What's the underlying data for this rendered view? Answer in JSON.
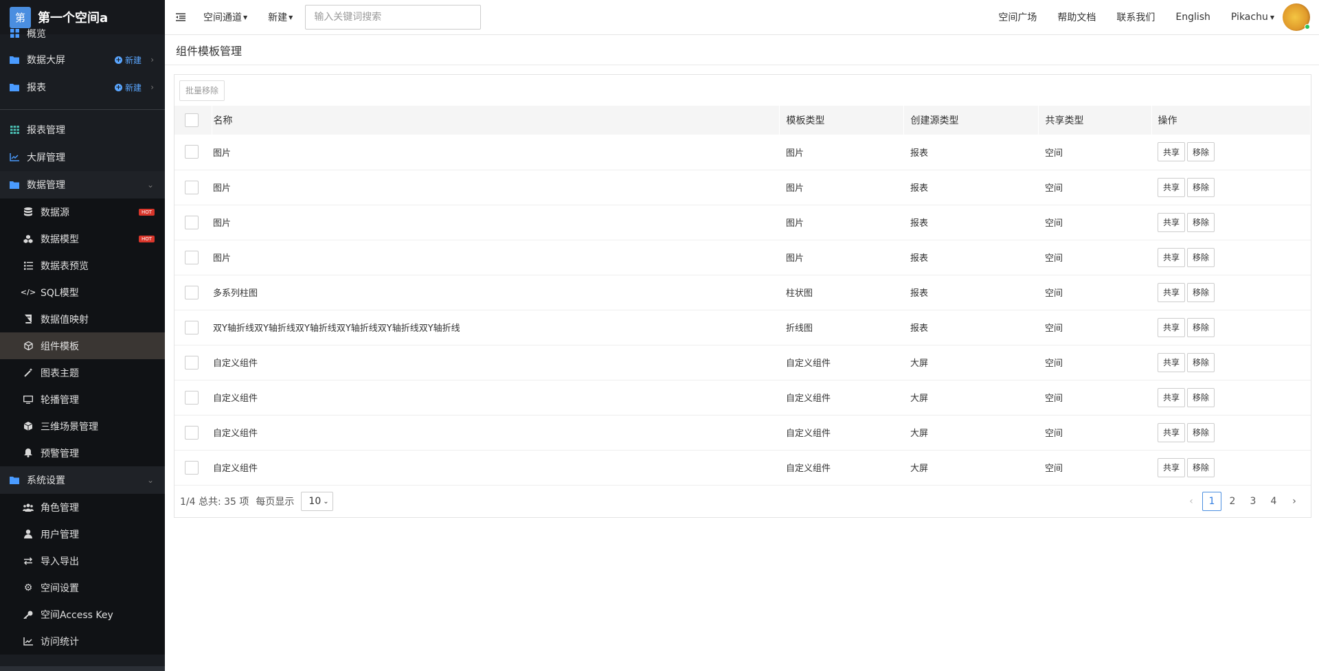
{
  "brand": {
    "logo_char": "第",
    "title": "第一个空间a"
  },
  "sidebar": {
    "overview": "概览",
    "dashboard": {
      "label": "数据大屏",
      "new_label": "新建"
    },
    "report": {
      "label": "报表",
      "new_label": "新建"
    },
    "report_mgmt": "报表管理",
    "screen_mgmt": "大屏管理",
    "data_mgmt": "数据管理",
    "data_sub": [
      {
        "label": "数据源",
        "badge": "HOT"
      },
      {
        "label": "数据模型",
        "badge": "HOT"
      },
      {
        "label": "数据表预览"
      },
      {
        "label": "SQL模型"
      },
      {
        "label": "数据值映射"
      },
      {
        "label": "组件模板"
      },
      {
        "label": "图表主题"
      },
      {
        "label": "轮播管理"
      },
      {
        "label": "三维场景管理"
      },
      {
        "label": "预警管理"
      }
    ],
    "system": "系统设置",
    "system_sub": [
      {
        "label": "角色管理"
      },
      {
        "label": "用户管理"
      },
      {
        "label": "导入导出"
      },
      {
        "label": "空间设置"
      },
      {
        "label": "空间Access Key"
      },
      {
        "label": "访问统计"
      }
    ]
  },
  "topbar": {
    "space_channel": "空间通道",
    "new": "新建",
    "search_placeholder": "输入关键词搜索",
    "links": [
      "空间广场",
      "帮助文档",
      "联系我们",
      "English"
    ],
    "user": "Pikachu"
  },
  "page": {
    "title": "组件模板管理",
    "batch_remove": "批量移除"
  },
  "table": {
    "headers": {
      "name": "名称",
      "type": "模板类型",
      "source": "创建源类型",
      "share": "共享类型",
      "ops": "操作"
    },
    "share_btn": "共享",
    "remove_btn": "移除",
    "rows": [
      {
        "name": "图片",
        "type": "图片",
        "source": "报表",
        "share": "空间"
      },
      {
        "name": "图片",
        "type": "图片",
        "source": "报表",
        "share": "空间"
      },
      {
        "name": "图片",
        "type": "图片",
        "source": "报表",
        "share": "空间"
      },
      {
        "name": "图片",
        "type": "图片",
        "source": "报表",
        "share": "空间"
      },
      {
        "name": "多系列柱图",
        "type": "柱状图",
        "source": "报表",
        "share": "空间"
      },
      {
        "name": "双Y轴折线双Y轴折线双Y轴折线双Y轴折线双Y轴折线双Y轴折线",
        "type": "折线图",
        "source": "报表",
        "share": "空间"
      },
      {
        "name": "自定义组件",
        "type": "自定义组件",
        "source": "大屏",
        "share": "空间"
      },
      {
        "name": "自定义组件",
        "type": "自定义组件",
        "source": "大屏",
        "share": "空间"
      },
      {
        "name": "自定义组件",
        "type": "自定义组件",
        "source": "大屏",
        "share": "空间"
      },
      {
        "name": "自定义组件",
        "type": "自定义组件",
        "source": "大屏",
        "share": "空间"
      }
    ]
  },
  "pagination": {
    "summary": "1/4 总共: 35 项",
    "per_page_label": "每页显示",
    "per_page_value": "10",
    "pages": [
      "1",
      "2",
      "3",
      "4"
    ],
    "current": "1"
  }
}
